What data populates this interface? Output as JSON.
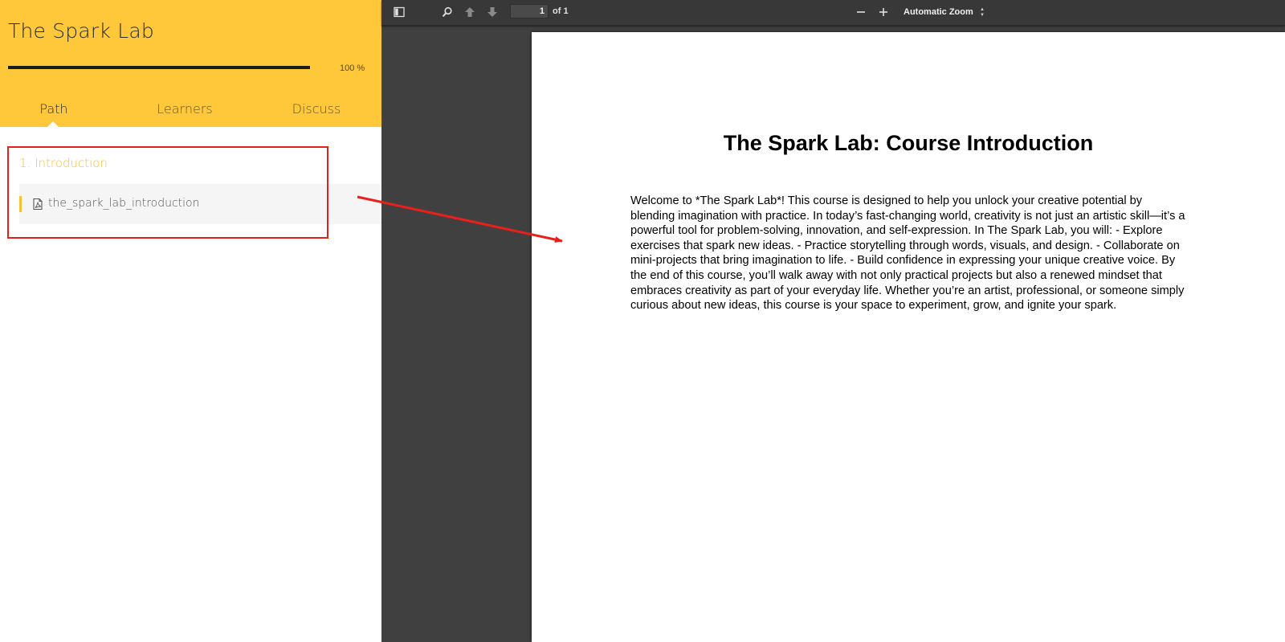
{
  "course": {
    "title": "The Spark Lab",
    "progress_percent": 100,
    "progress_label": "100 %",
    "tabs": [
      {
        "label": "Path",
        "active": true
      },
      {
        "label": "Learners",
        "active": false
      },
      {
        "label": "Discuss",
        "active": false
      }
    ],
    "section": {
      "title": "1. Introduction",
      "items": [
        {
          "label": "the_spark_lab_introduction",
          "icon": "pdf-icon"
        }
      ]
    }
  },
  "viewer": {
    "page_number": "1",
    "page_count": "of 1",
    "zoom_label": "Automatic Zoom",
    "icons": {
      "sidebar_toggle": "sidebar-toggle-icon",
      "search": "search-icon",
      "previous": "arrow-up-icon",
      "next": "arrow-down-icon",
      "zoom_out": "minus-icon",
      "zoom_in": "plus-icon"
    }
  },
  "document": {
    "title": "The Spark Lab: Course Introduction",
    "body": "Welcome to *The Spark Lab*! This course is designed to help you unlock your creative potential by blending imagination with practice. In today’s fast-changing world, creativity is not just an artistic skill—it’s a powerful tool for problem-solving, innovation, and self-expression. In The Spark Lab, you will: - Explore exercises that spark new ideas. - Practice storytelling through words, visuals, and design. - Collaborate on mini-projects that bring imagination to life. - Build confidence in expressing your unique creative voice. By the end of this course, you’ll walk away with not only practical projects but also a renewed mindset that embraces creativity as part of your everyday life. Whether you’re an artist, professional, or someone simply curious about new ideas, this course is your space to experiment, grow, and ignite your spark."
  },
  "annotation": {
    "highlight_color": "#e8201c"
  },
  "colors": {
    "accent": "#ffc83a",
    "section_title": "#f7c137",
    "viewer_background": "#404040"
  }
}
